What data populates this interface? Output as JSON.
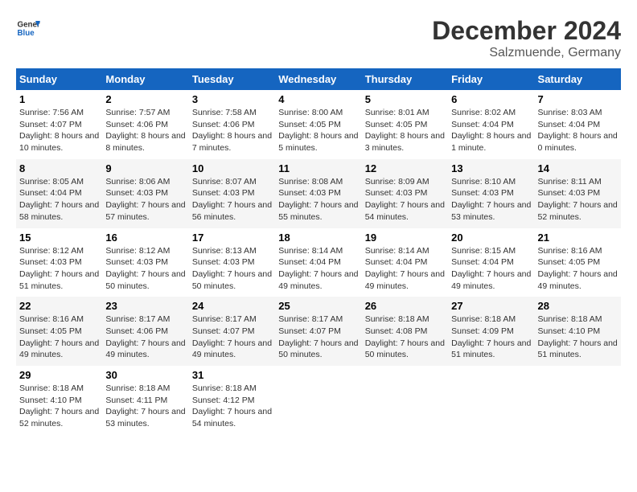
{
  "header": {
    "logo": {
      "general": "General",
      "blue": "Blue"
    },
    "title": "December 2024",
    "location": "Salzmuende, Germany"
  },
  "columns": [
    "Sunday",
    "Monday",
    "Tuesday",
    "Wednesday",
    "Thursday",
    "Friday",
    "Saturday"
  ],
  "weeks": [
    [
      {
        "day": "1",
        "sunrise": "Sunrise: 7:56 AM",
        "sunset": "Sunset: 4:07 PM",
        "daylight": "Daylight: 8 hours and 10 minutes."
      },
      {
        "day": "2",
        "sunrise": "Sunrise: 7:57 AM",
        "sunset": "Sunset: 4:06 PM",
        "daylight": "Daylight: 8 hours and 8 minutes."
      },
      {
        "day": "3",
        "sunrise": "Sunrise: 7:58 AM",
        "sunset": "Sunset: 4:06 PM",
        "daylight": "Daylight: 8 hours and 7 minutes."
      },
      {
        "day": "4",
        "sunrise": "Sunrise: 8:00 AM",
        "sunset": "Sunset: 4:05 PM",
        "daylight": "Daylight: 8 hours and 5 minutes."
      },
      {
        "day": "5",
        "sunrise": "Sunrise: 8:01 AM",
        "sunset": "Sunset: 4:05 PM",
        "daylight": "Daylight: 8 hours and 3 minutes."
      },
      {
        "day": "6",
        "sunrise": "Sunrise: 8:02 AM",
        "sunset": "Sunset: 4:04 PM",
        "daylight": "Daylight: 8 hours and 1 minute."
      },
      {
        "day": "7",
        "sunrise": "Sunrise: 8:03 AM",
        "sunset": "Sunset: 4:04 PM",
        "daylight": "Daylight: 8 hours and 0 minutes."
      }
    ],
    [
      {
        "day": "8",
        "sunrise": "Sunrise: 8:05 AM",
        "sunset": "Sunset: 4:04 PM",
        "daylight": "Daylight: 7 hours and 58 minutes."
      },
      {
        "day": "9",
        "sunrise": "Sunrise: 8:06 AM",
        "sunset": "Sunset: 4:03 PM",
        "daylight": "Daylight: 7 hours and 57 minutes."
      },
      {
        "day": "10",
        "sunrise": "Sunrise: 8:07 AM",
        "sunset": "Sunset: 4:03 PM",
        "daylight": "Daylight: 7 hours and 56 minutes."
      },
      {
        "day": "11",
        "sunrise": "Sunrise: 8:08 AM",
        "sunset": "Sunset: 4:03 PM",
        "daylight": "Daylight: 7 hours and 55 minutes."
      },
      {
        "day": "12",
        "sunrise": "Sunrise: 8:09 AM",
        "sunset": "Sunset: 4:03 PM",
        "daylight": "Daylight: 7 hours and 54 minutes."
      },
      {
        "day": "13",
        "sunrise": "Sunrise: 8:10 AM",
        "sunset": "Sunset: 4:03 PM",
        "daylight": "Daylight: 7 hours and 53 minutes."
      },
      {
        "day": "14",
        "sunrise": "Sunrise: 8:11 AM",
        "sunset": "Sunset: 4:03 PM",
        "daylight": "Daylight: 7 hours and 52 minutes."
      }
    ],
    [
      {
        "day": "15",
        "sunrise": "Sunrise: 8:12 AM",
        "sunset": "Sunset: 4:03 PM",
        "daylight": "Daylight: 7 hours and 51 minutes."
      },
      {
        "day": "16",
        "sunrise": "Sunrise: 8:12 AM",
        "sunset": "Sunset: 4:03 PM",
        "daylight": "Daylight: 7 hours and 50 minutes."
      },
      {
        "day": "17",
        "sunrise": "Sunrise: 8:13 AM",
        "sunset": "Sunset: 4:03 PM",
        "daylight": "Daylight: 7 hours and 50 minutes."
      },
      {
        "day": "18",
        "sunrise": "Sunrise: 8:14 AM",
        "sunset": "Sunset: 4:04 PM",
        "daylight": "Daylight: 7 hours and 49 minutes."
      },
      {
        "day": "19",
        "sunrise": "Sunrise: 8:14 AM",
        "sunset": "Sunset: 4:04 PM",
        "daylight": "Daylight: 7 hours and 49 minutes."
      },
      {
        "day": "20",
        "sunrise": "Sunrise: 8:15 AM",
        "sunset": "Sunset: 4:04 PM",
        "daylight": "Daylight: 7 hours and 49 minutes."
      },
      {
        "day": "21",
        "sunrise": "Sunrise: 8:16 AM",
        "sunset": "Sunset: 4:05 PM",
        "daylight": "Daylight: 7 hours and 49 minutes."
      }
    ],
    [
      {
        "day": "22",
        "sunrise": "Sunrise: 8:16 AM",
        "sunset": "Sunset: 4:05 PM",
        "daylight": "Daylight: 7 hours and 49 minutes."
      },
      {
        "day": "23",
        "sunrise": "Sunrise: 8:17 AM",
        "sunset": "Sunset: 4:06 PM",
        "daylight": "Daylight: 7 hours and 49 minutes."
      },
      {
        "day": "24",
        "sunrise": "Sunrise: 8:17 AM",
        "sunset": "Sunset: 4:07 PM",
        "daylight": "Daylight: 7 hours and 49 minutes."
      },
      {
        "day": "25",
        "sunrise": "Sunrise: 8:17 AM",
        "sunset": "Sunset: 4:07 PM",
        "daylight": "Daylight: 7 hours and 50 minutes."
      },
      {
        "day": "26",
        "sunrise": "Sunrise: 8:18 AM",
        "sunset": "Sunset: 4:08 PM",
        "daylight": "Daylight: 7 hours and 50 minutes."
      },
      {
        "day": "27",
        "sunrise": "Sunrise: 8:18 AM",
        "sunset": "Sunset: 4:09 PM",
        "daylight": "Daylight: 7 hours and 51 minutes."
      },
      {
        "day": "28",
        "sunrise": "Sunrise: 8:18 AM",
        "sunset": "Sunset: 4:10 PM",
        "daylight": "Daylight: 7 hours and 51 minutes."
      }
    ],
    [
      {
        "day": "29",
        "sunrise": "Sunrise: 8:18 AM",
        "sunset": "Sunset: 4:10 PM",
        "daylight": "Daylight: 7 hours and 52 minutes."
      },
      {
        "day": "30",
        "sunrise": "Sunrise: 8:18 AM",
        "sunset": "Sunset: 4:11 PM",
        "daylight": "Daylight: 7 hours and 53 minutes."
      },
      {
        "day": "31",
        "sunrise": "Sunrise: 8:18 AM",
        "sunset": "Sunset: 4:12 PM",
        "daylight": "Daylight: 7 hours and 54 minutes."
      },
      {
        "day": "",
        "sunrise": "",
        "sunset": "",
        "daylight": ""
      },
      {
        "day": "",
        "sunrise": "",
        "sunset": "",
        "daylight": ""
      },
      {
        "day": "",
        "sunrise": "",
        "sunset": "",
        "daylight": ""
      },
      {
        "day": "",
        "sunrise": "",
        "sunset": "",
        "daylight": ""
      }
    ]
  ]
}
